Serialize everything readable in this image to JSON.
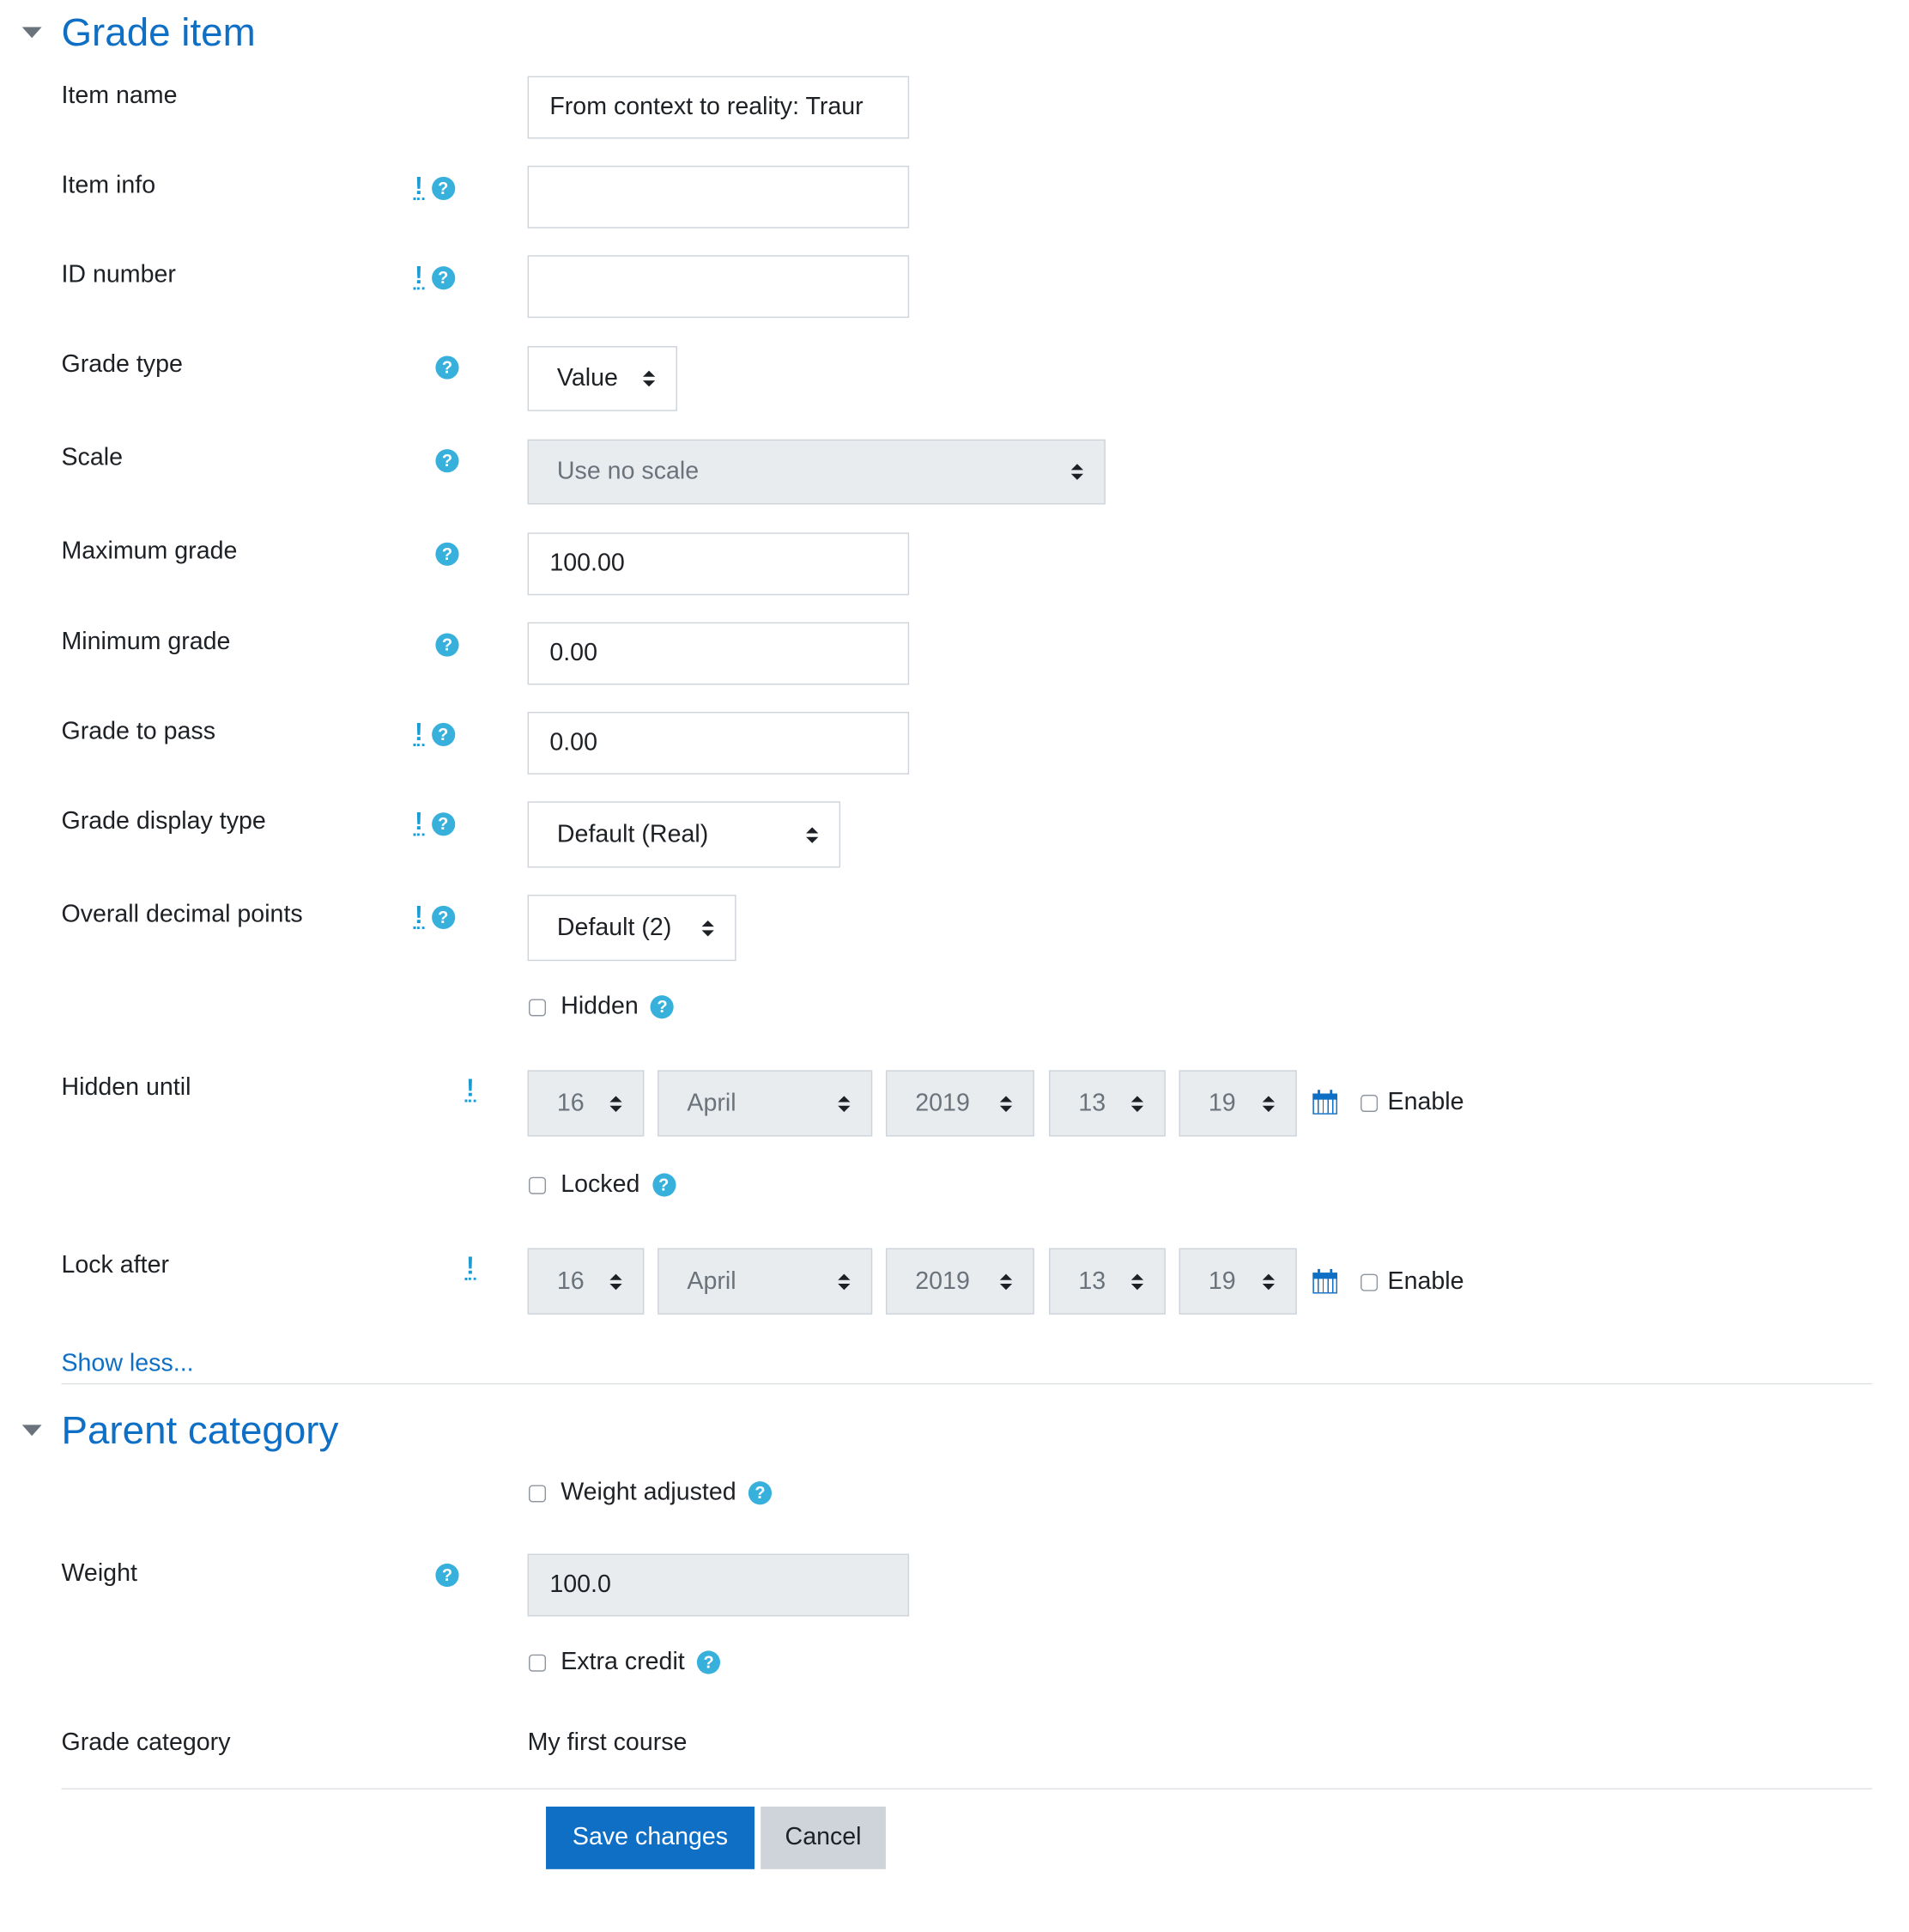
{
  "grade_item": {
    "title": "Grade item",
    "item_name": {
      "label": "Item name",
      "value": "From context to reality: Traur"
    },
    "item_info": {
      "label": "Item info",
      "value": ""
    },
    "id_number": {
      "label": "ID number",
      "value": ""
    },
    "grade_type": {
      "label": "Grade type",
      "value": "Value"
    },
    "scale": {
      "label": "Scale",
      "value": "Use no scale"
    },
    "maximum_grade": {
      "label": "Maximum grade",
      "value": "100.00"
    },
    "minimum_grade": {
      "label": "Minimum grade",
      "value": "0.00"
    },
    "grade_to_pass": {
      "label": "Grade to pass",
      "value": "0.00"
    },
    "grade_display_type": {
      "label": "Grade display type",
      "value": "Default (Real)"
    },
    "overall_decimal_points": {
      "label": "Overall decimal points",
      "value": "Default (2)"
    },
    "hidden": {
      "label": "Hidden"
    },
    "hidden_until": {
      "label": "Hidden until",
      "day": "16",
      "month": "April",
      "year": "2019",
      "hour": "13",
      "minute": "19",
      "enable_label": "Enable"
    },
    "locked": {
      "label": "Locked"
    },
    "lock_after": {
      "label": "Lock after",
      "day": "16",
      "month": "April",
      "year": "2019",
      "hour": "13",
      "minute": "19",
      "enable_label": "Enable"
    },
    "show_less": "Show less..."
  },
  "parent_category": {
    "title": "Parent category",
    "weight_adjusted": {
      "label": "Weight adjusted"
    },
    "weight": {
      "label": "Weight",
      "value": "100.0"
    },
    "extra_credit": {
      "label": "Extra credit"
    },
    "grade_category": {
      "label": "Grade category",
      "value": "My first course"
    }
  },
  "buttons": {
    "save": "Save changes",
    "cancel": "Cancel"
  },
  "icons": {
    "help": "?",
    "advanced": "!"
  },
  "colors": {
    "link": "#0f6fc5",
    "help_icon": "#37b0dc",
    "primary_button": "#0f6fc5",
    "secondary_button": "#ced4da",
    "disabled_bg": "#e9ecef"
  }
}
